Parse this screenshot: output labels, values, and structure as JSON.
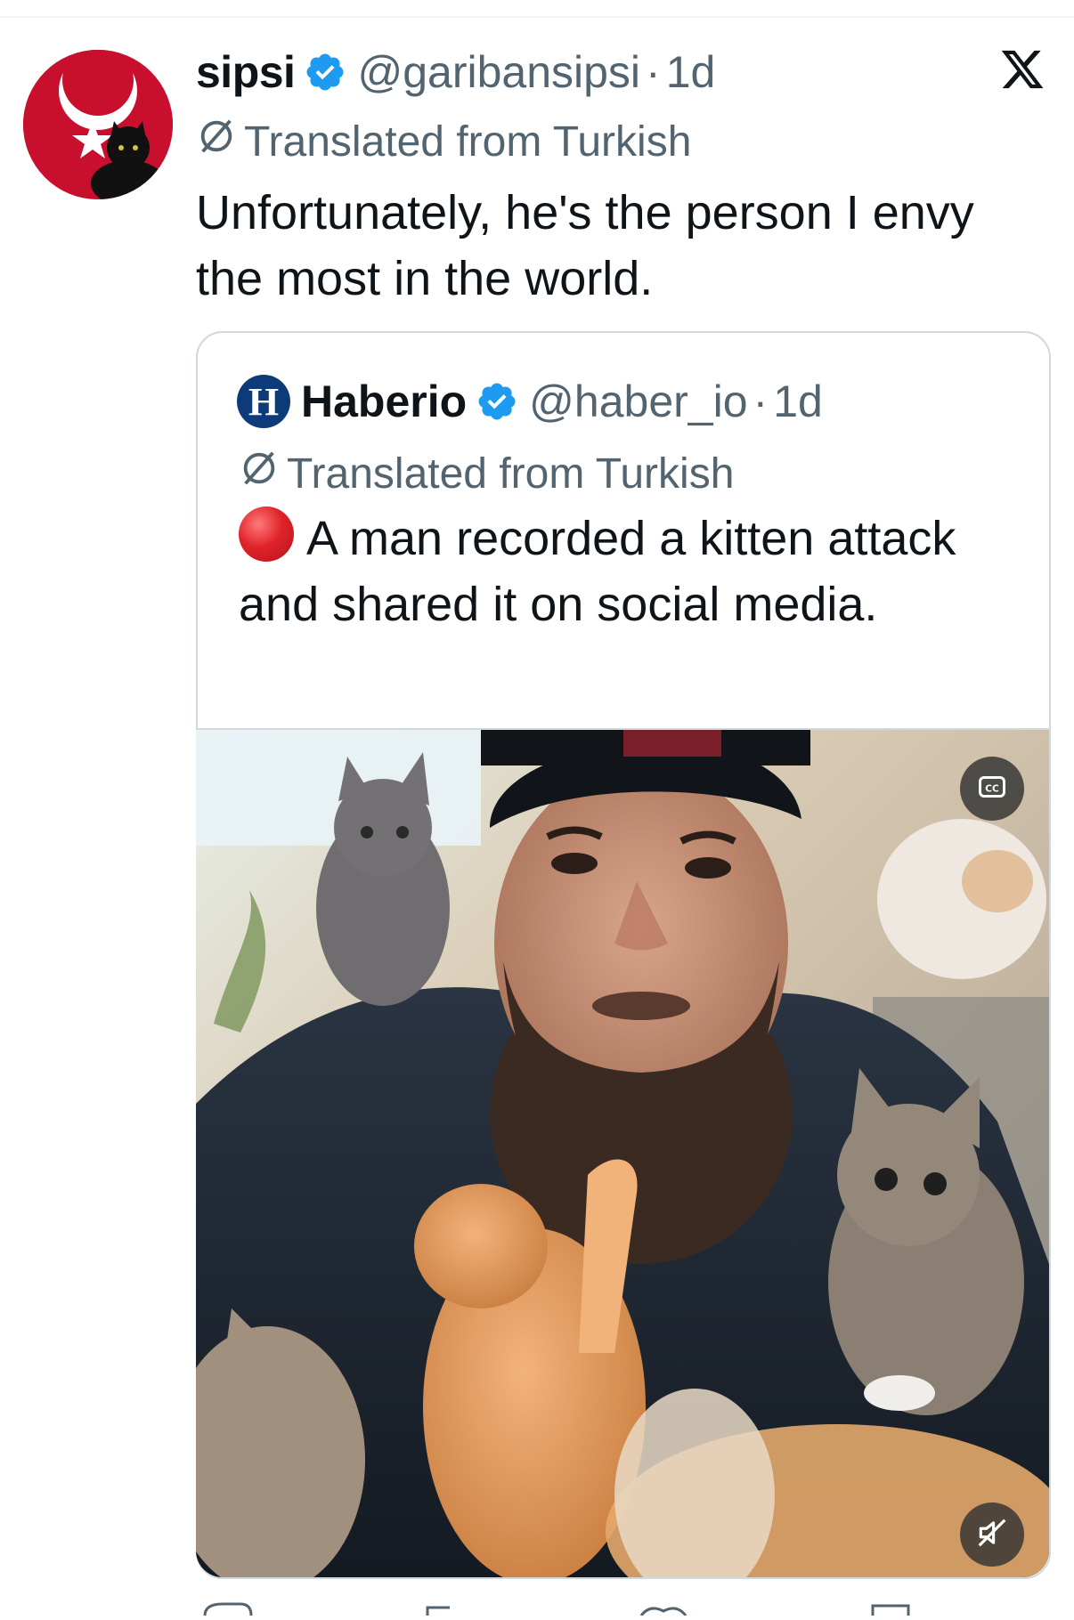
{
  "post": {
    "author_name": "sipsi",
    "handle": "@garibansipsi",
    "separator": "·",
    "time": "1d",
    "translated_label": "Translated from Turkish",
    "text": "Unfortunately, he's the person I envy the most in the world."
  },
  "quoted_post": {
    "logo_letter": "H",
    "author_name": "Haberio",
    "handle": "@haber_io",
    "separator": "·",
    "time": "1d",
    "translated_label": "Translated from Turkish",
    "text": "A man recorded a kitten attack and shared it on social media.",
    "media": {
      "type": "video",
      "description_icon": "video-thumbnail",
      "captions_label": "CC"
    }
  },
  "icons": {
    "verified": "verified-badge-icon",
    "translate": "translate-icon",
    "platform": "x-logo-icon",
    "captions": "captions-icon",
    "mute": "mute-icon",
    "red_circle": "red-circle-emoji"
  },
  "colors": {
    "verified_blue": "#1d9bf0",
    "secondary_text": "#536471",
    "primary_text": "#0f1419",
    "border": "#cfd9de"
  }
}
